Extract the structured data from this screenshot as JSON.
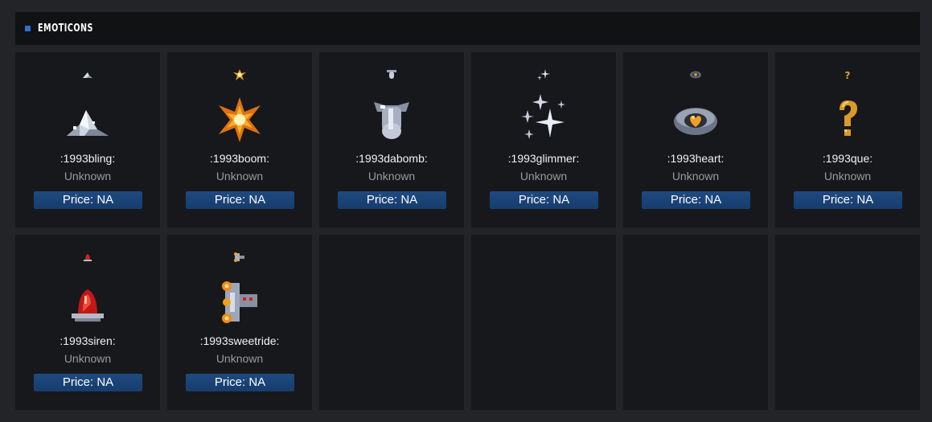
{
  "section": {
    "title": "EMOTICONS",
    "accent": "#2f6fd0"
  },
  "price_prefix": "Price: ",
  "items": [
    {
      "name": ":1993bling:",
      "rarity": "Unknown",
      "price": "Price: NA",
      "icon": "bling-icon"
    },
    {
      "name": ":1993boom:",
      "rarity": "Unknown",
      "price": "Price: NA",
      "icon": "boom-icon"
    },
    {
      "name": ":1993dabomb:",
      "rarity": "Unknown",
      "price": "Price: NA",
      "icon": "bomb-icon"
    },
    {
      "name": ":1993glimmer:",
      "rarity": "Unknown",
      "price": "Price: NA",
      "icon": "glimmer-icon"
    },
    {
      "name": ":1993heart:",
      "rarity": "Unknown",
      "price": "Price: NA",
      "icon": "heart-icon"
    },
    {
      "name": ":1993que:",
      "rarity": "Unknown",
      "price": "Price: NA",
      "icon": "question-icon"
    },
    {
      "name": ":1993siren:",
      "rarity": "Unknown",
      "price": "Price: NA",
      "icon": "siren-icon"
    },
    {
      "name": ":1993sweetride:",
      "rarity": "Unknown",
      "price": "Price: NA",
      "icon": "sweetride-icon"
    }
  ]
}
